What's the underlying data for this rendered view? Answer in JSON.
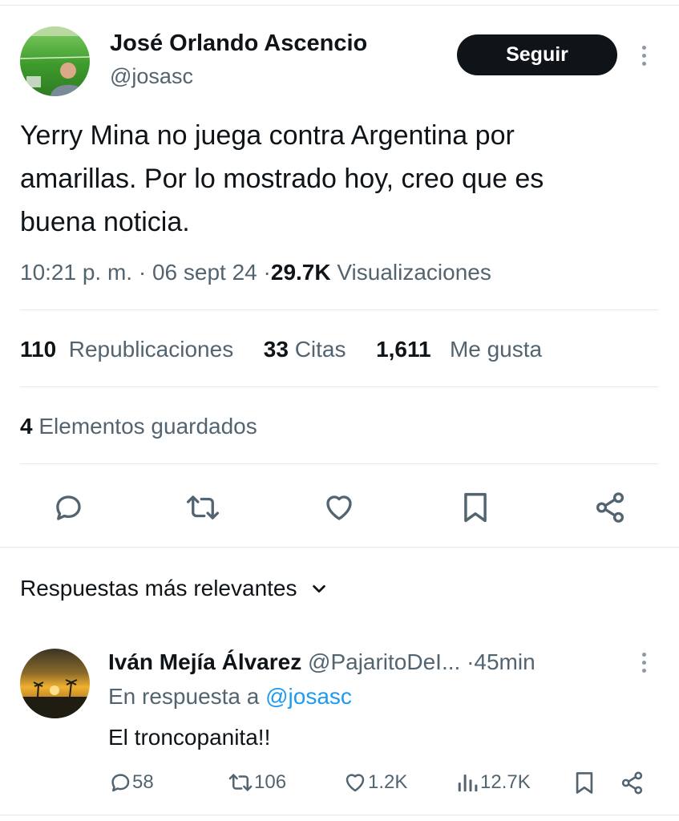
{
  "tweet": {
    "author": {
      "name": "José Orlando Ascencio",
      "handle": "@josasc"
    },
    "follow_label": "Seguir",
    "text_lines": [
      "Yerry Mina no juega contra Argentina por",
      "amarillas. Por lo mostrado hoy, creo que es",
      "buena noticia."
    ],
    "time": "10:21 p. m.",
    "sep": "·",
    "date": "06 sept 24",
    "views_count": "29.7K",
    "views_label": "Visualizaciones",
    "stats": {
      "reposts_count": "110",
      "reposts_label": "Republicaciones",
      "quotes_count": "33",
      "quotes_label": "Citas",
      "likes_count": "1,611",
      "likes_label": "Me gusta",
      "bookmarks_count": "4",
      "bookmarks_label": "Elementos guardados"
    },
    "actions": [
      "reply-icon",
      "retweet-icon",
      "heart-icon",
      "bookmark-icon",
      "share-icon"
    ]
  },
  "replies_header": {
    "label": "Respuestas más relevantes"
  },
  "reply": {
    "name": "Iván Mejía Álvarez",
    "handle": "@PajaritoDeI...",
    "sep": "·",
    "time": "45min",
    "reply_to_prefix": "En respuesta a",
    "reply_to_handle": "@josasc",
    "text": "El troncopanita!!",
    "replies": "58",
    "reposts": "106",
    "likes": "1.2K",
    "views": "12.7K"
  },
  "colors": {
    "link": "#1d9bf0",
    "text": "#0f1419",
    "muted": "#536471",
    "button": "#0f1419"
  }
}
